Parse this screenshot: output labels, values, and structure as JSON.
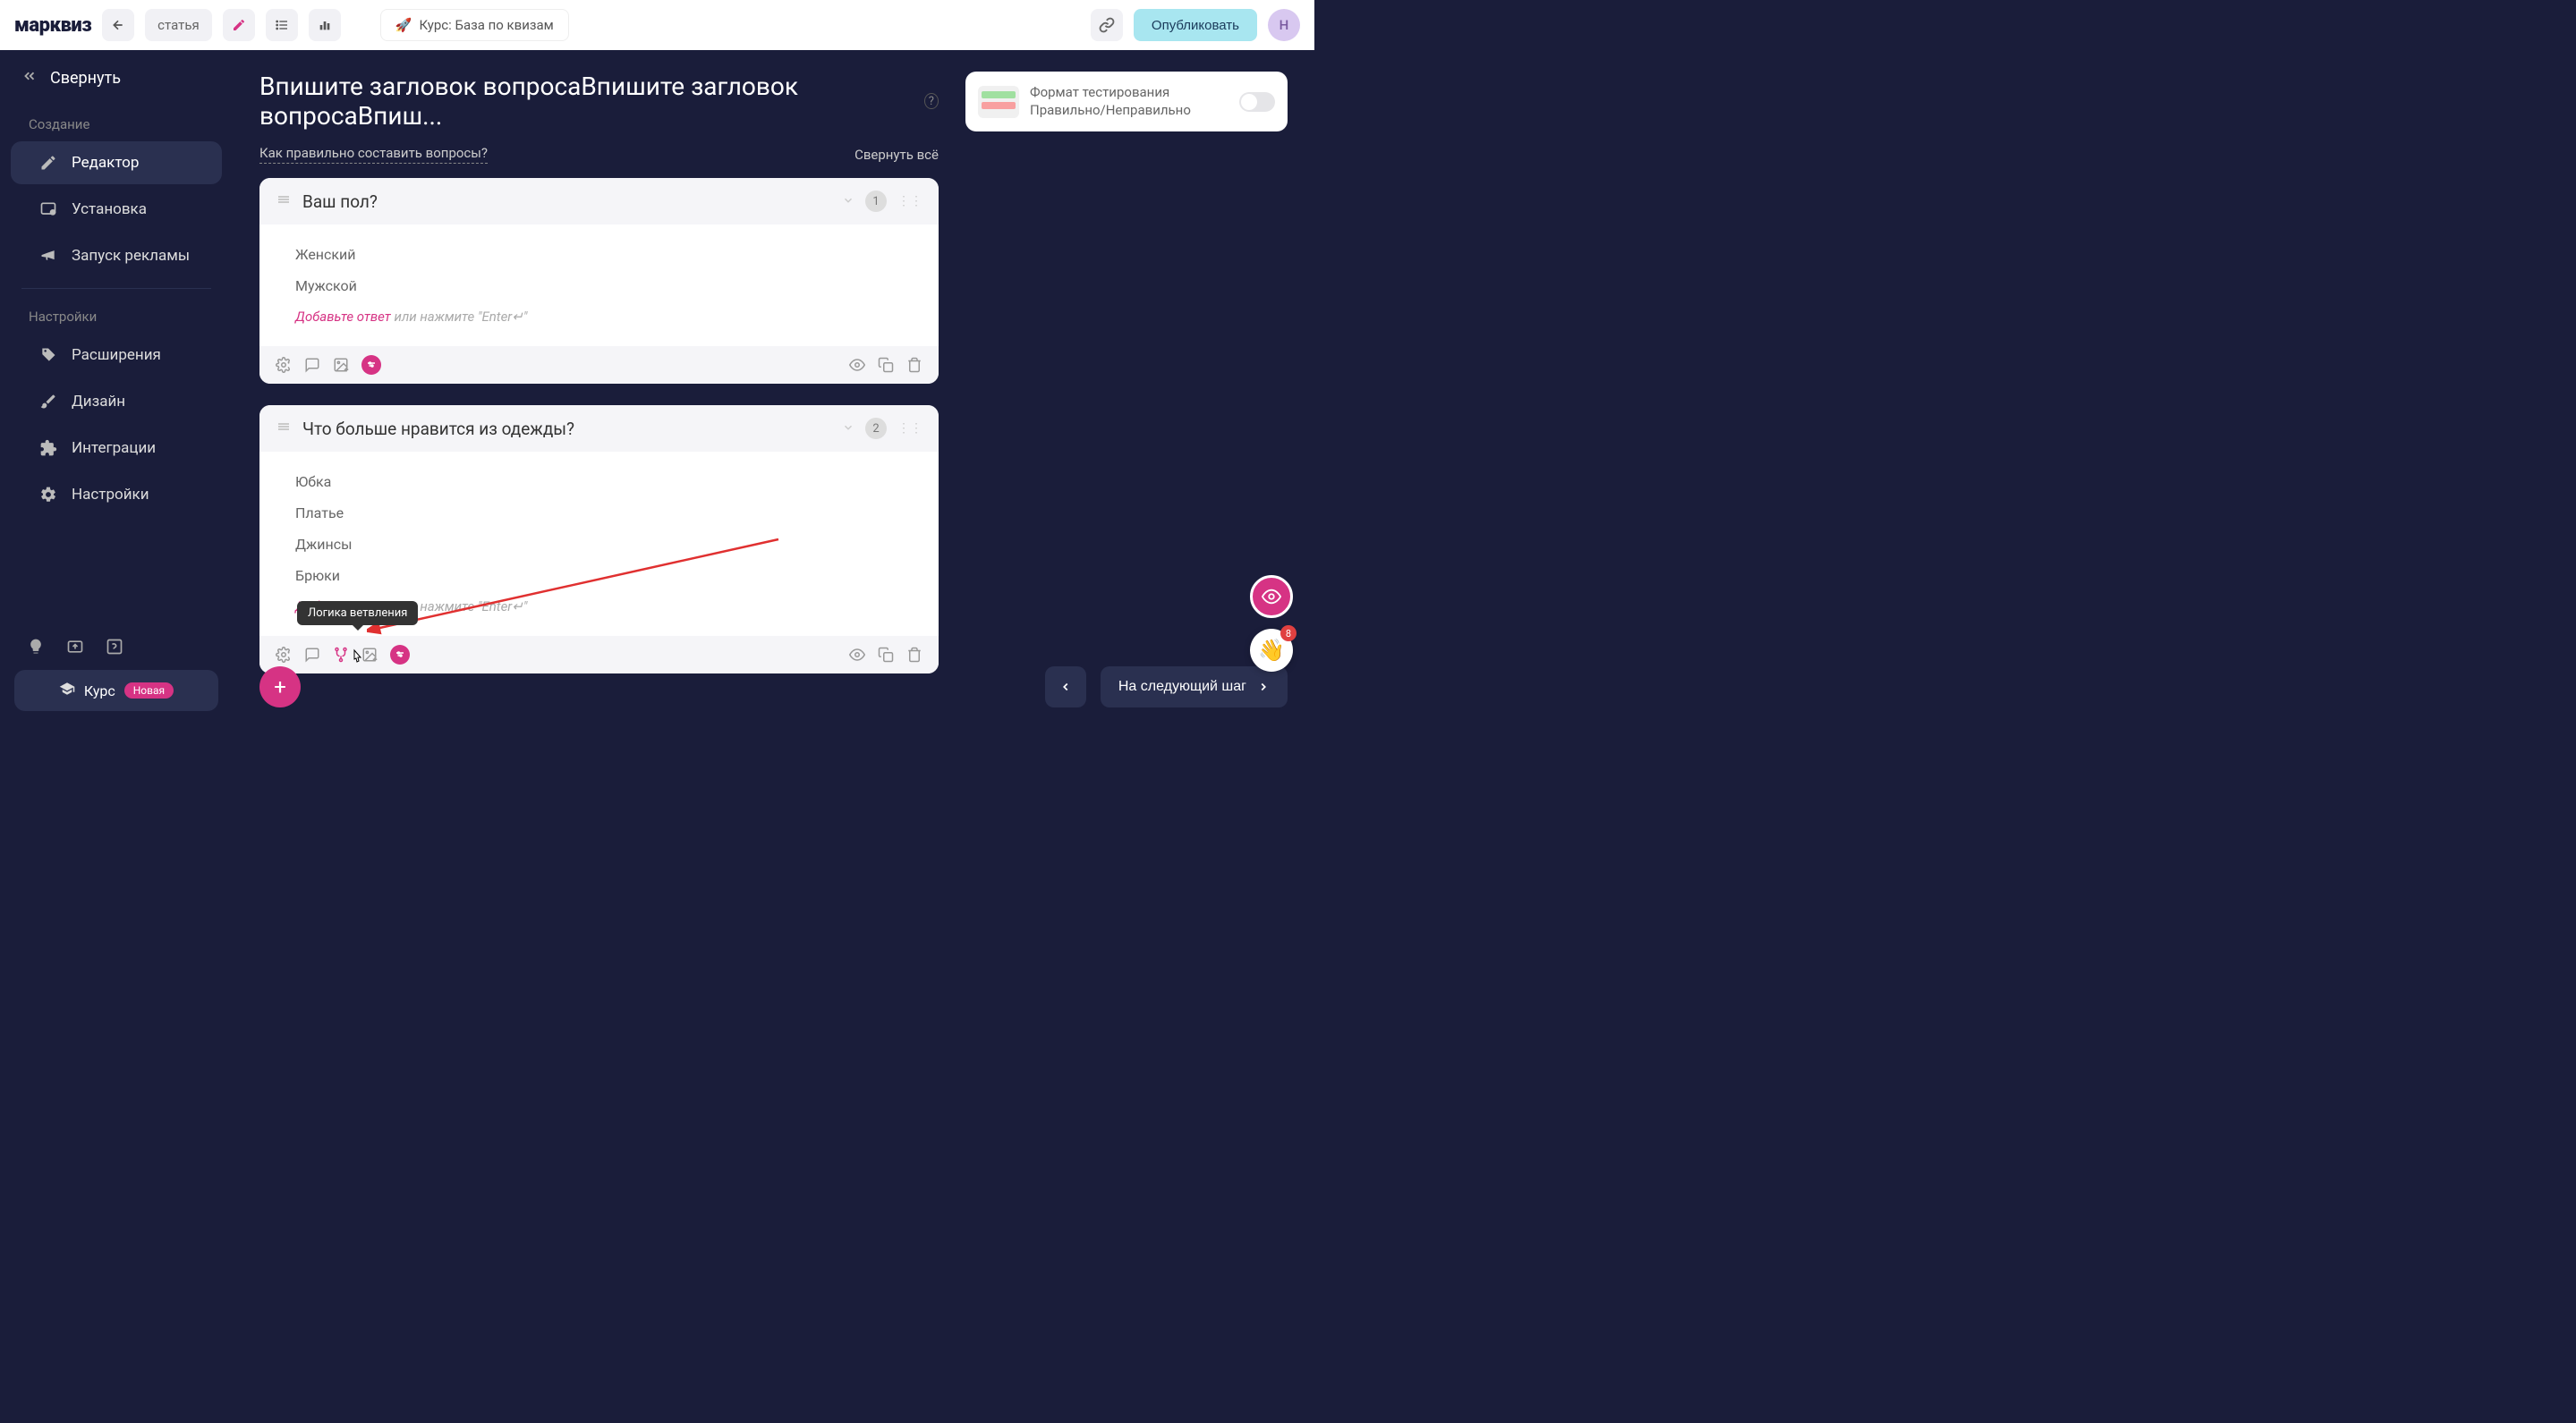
{
  "topbar": {
    "logo": "марквиз",
    "article_label": "статья",
    "course_label": "Курс: База по квизам",
    "course_emoji": "🚀",
    "publish_label": "Опубликовать",
    "avatar_letter": "Н"
  },
  "sidebar": {
    "collapse_label": "Свернуть",
    "sections": {
      "create": "Создание",
      "settings": "Настройки"
    },
    "items": {
      "editor": "Редактор",
      "install": "Установка",
      "ads": "Запуск рекламы",
      "extensions": "Расширения",
      "design": "Дизайн",
      "integrations": "Интеграции",
      "settings_item": "Настройки"
    },
    "course_button": "Курс",
    "badge_new": "Новая"
  },
  "content": {
    "title": "Впишите загловок вопросаВпишите загловок вопросаВпиш...",
    "hint_link": "Как правильно составить вопросы?",
    "collapse_all": "Свернуть всё",
    "add_answer_pink": "Добавьте ответ",
    "add_answer_grey": " или нажмите \"Enter↵\"",
    "questions": [
      {
        "num": "1",
        "title": "Ваш пол?",
        "answers": [
          "Женский",
          "Мужской"
        ]
      },
      {
        "num": "2",
        "title": "Что больше нравится из одежды?",
        "answers": [
          "Юбка",
          "Платье",
          "Джинсы",
          "Брюки"
        ]
      }
    ],
    "tooltip": "Логика ветвления"
  },
  "side_panel": {
    "line1": "Формат тестирования",
    "line2": "Правильно/Неправильно"
  },
  "bottom": {
    "next_step": "На следующий шаг",
    "notif_count": "8",
    "wave_emoji": "👋"
  }
}
